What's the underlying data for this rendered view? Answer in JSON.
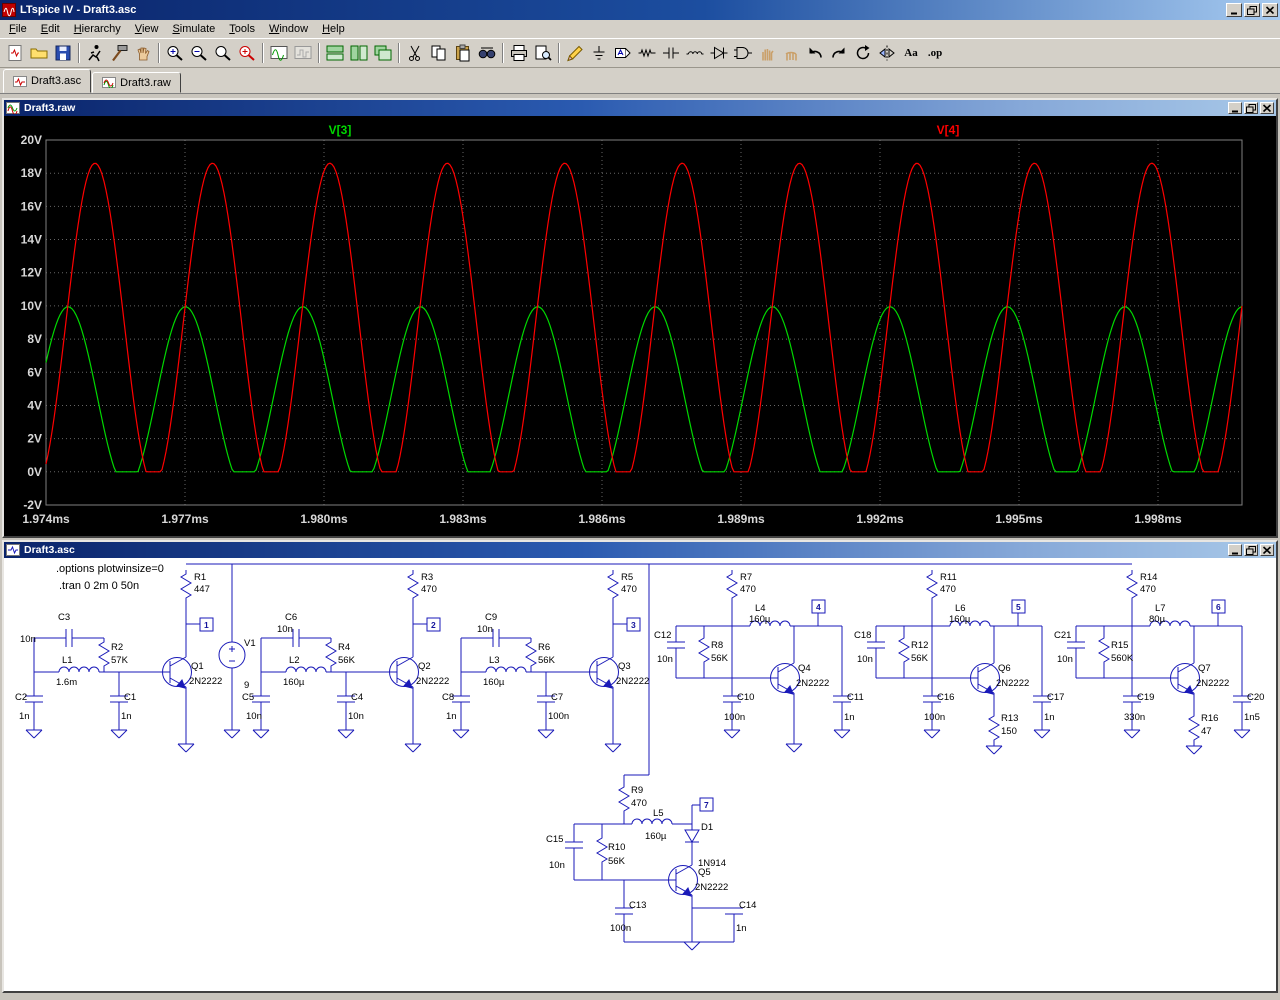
{
  "app": {
    "title": "LTspice IV - Draft3.asc"
  },
  "window_controls": [
    "minimize",
    "restore",
    "close"
  ],
  "menu": {
    "items": [
      "File",
      "Edit",
      "Hierarchy",
      "View",
      "Simulate",
      "Tools",
      "Window",
      "Help"
    ]
  },
  "toolbar": {
    "groups": [
      [
        {
          "name": "new-schematic"
        },
        {
          "name": "open"
        },
        {
          "name": "save"
        }
      ],
      [
        {
          "name": "run"
        },
        {
          "name": "halt"
        },
        {
          "name": "pause"
        }
      ],
      [
        {
          "name": "zoom-in"
        },
        {
          "name": "zoom-out"
        },
        {
          "name": "zoom-area"
        },
        {
          "name": "zoom-full"
        }
      ],
      [
        {
          "name": "autorange-y"
        },
        {
          "name": "plot-settings"
        }
      ],
      [
        {
          "name": "tile-horizontal"
        },
        {
          "name": "tile-vertical"
        },
        {
          "name": "cascade"
        }
      ],
      [
        {
          "name": "cut"
        },
        {
          "name": "copy"
        },
        {
          "name": "paste"
        },
        {
          "name": "find"
        }
      ],
      [
        {
          "name": "print"
        },
        {
          "name": "print-preview"
        }
      ],
      [
        {
          "name": "wire"
        },
        {
          "name": "ground"
        },
        {
          "name": "net-label"
        },
        {
          "name": "resistor"
        },
        {
          "name": "capacitor"
        },
        {
          "name": "inductor"
        },
        {
          "name": "diode"
        },
        {
          "name": "component"
        },
        {
          "name": "move"
        },
        {
          "name": "drag"
        },
        {
          "name": "undo"
        },
        {
          "name": "redo"
        },
        {
          "name": "rotate"
        },
        {
          "name": "mirror"
        },
        {
          "name": "text-tool",
          "glyph": "Aa"
        },
        {
          "name": "spice-directive",
          "glyph": ".op"
        }
      ]
    ]
  },
  "tabs": [
    {
      "label": "Draft3.asc",
      "icon": "schematic-tab-icon",
      "active": true
    },
    {
      "label": "Draft3.raw",
      "icon": "waveform-tab-icon",
      "active": false
    }
  ],
  "waveform_window": {
    "title": "Draft3.raw"
  },
  "schematic_window": {
    "title": "Draft3.asc"
  },
  "chart_data": {
    "type": "line",
    "background": "#000000",
    "grid": true,
    "x_axis": {
      "unit": "ms",
      "range_ms": [
        1.974,
        1.99981
      ],
      "ticks": [
        "1.974ms",
        "1.977ms",
        "1.980ms",
        "1.983ms",
        "1.986ms",
        "1.989ms",
        "1.992ms",
        "1.995ms",
        "1.998ms"
      ]
    },
    "y_axis": {
      "unit": "V",
      "range_v": [
        -2,
        20
      ],
      "ticks": [
        "20V",
        "18V",
        "16V",
        "14V",
        "12V",
        "10V",
        "8V",
        "6V",
        "4V",
        "2V",
        "0V",
        "-2V"
      ]
    },
    "series": [
      {
        "name": "V[3]",
        "color": "#00d800",
        "waveform": "clipped-sine",
        "peak_v": 9.95,
        "min_v": 0,
        "offset_v": 4.5,
        "amplitude_v": 5.45,
        "period_ms": 0.002534,
        "peak_time_ms": 1.974475
      },
      {
        "name": "V[4]",
        "color": "#ff0000",
        "waveform": "clipped-sine",
        "peak_v": 18.6,
        "min_v": 0,
        "offset_v": 8.9,
        "amplitude_v": 9.7,
        "period_ms": 0.002534,
        "peak_time_ms": 1.975058
      }
    ]
  },
  "schematic": {
    "directives": [
      ".options plotwinsize=0",
      ".tran 0 2m 0 50n"
    ],
    "components": {
      "R1": "447",
      "R2": "57K",
      "R3": "470",
      "R4": "56K",
      "R5": "470",
      "R6": "56K",
      "R7": "470",
      "R8": "56K",
      "R9": "470",
      "R10": "56K",
      "R11": "470",
      "R12": "56K",
      "R13": "150",
      "R14": "470",
      "R15": "560K",
      "R16": "47",
      "C1": "1n",
      "C2": "1n",
      "C3": "10n",
      "C4": "10n",
      "C5": "10n",
      "C6": "10n",
      "C7": "100n",
      "C8": "1n",
      "C9": "10n",
      "C10": "100n",
      "C11": "1n",
      "C12": "10n",
      "C13": "100n",
      "C14": "1n",
      "C15": "10n",
      "C16": "100n",
      "C17": "1n",
      "C18": "10n",
      "C19": "330n",
      "C20": "1n5",
      "C21": "10n",
      "L1": "1.6m",
      "L2": "160µ",
      "L3": "160µ",
      "L4": "160µ",
      "L5": "160µ",
      "L6": "160µ",
      "L7": "80µ",
      "Q1": "2N2222",
      "Q2": "2N2222",
      "Q3": "2N2222",
      "Q4": "2N2222",
      "Q5": "2N2222",
      "Q6": "2N2222",
      "Q7": "2N2222",
      "D1": "1N914",
      "V1": "9"
    },
    "flags": [
      "1",
      "2",
      "3",
      "4",
      "5",
      "6",
      "7"
    ]
  }
}
